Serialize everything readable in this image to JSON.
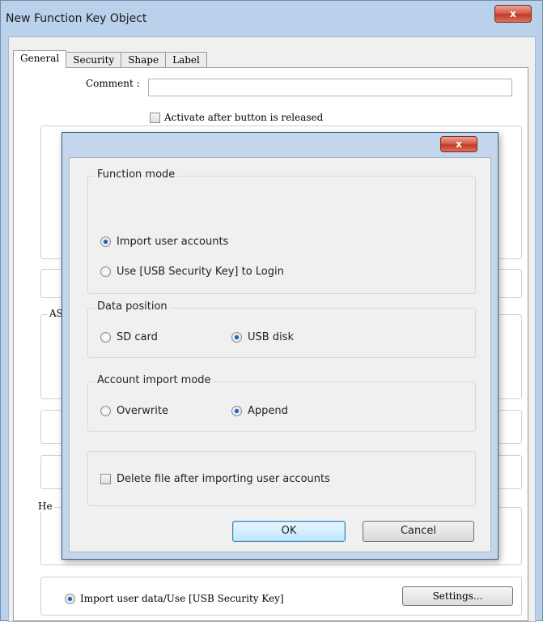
{
  "window": {
    "title": "New Function Key Object",
    "close_label": "x"
  },
  "tabs": [
    {
      "label": "General",
      "active": true
    },
    {
      "label": "Security",
      "active": false
    },
    {
      "label": "Shape",
      "active": false
    },
    {
      "label": "Label",
      "active": false
    }
  ],
  "general": {
    "comment_label": "Comment :",
    "comment_value": "",
    "activate_label": "Activate after button is released",
    "activate_checked": false,
    "group_captions": {
      "ascii": "AS",
      "hardware": "He"
    },
    "import_option_label": "Import user data/Use [USB Security Key]",
    "import_option_selected": true,
    "settings_button": "Settings..."
  },
  "dialog": {
    "close_label": "x",
    "function_mode": {
      "title": "Function mode",
      "options": [
        {
          "label": "Import user accounts",
          "selected": true
        },
        {
          "label": "Use [USB Security Key] to Login",
          "selected": false
        }
      ]
    },
    "data_position": {
      "title": "Data position",
      "options": [
        {
          "label": "SD card",
          "selected": false
        },
        {
          "label": "USB disk",
          "selected": true
        }
      ]
    },
    "account_import_mode": {
      "title": "Account import mode",
      "options": [
        {
          "label": "Overwrite",
          "selected": false
        },
        {
          "label": "Append",
          "selected": true
        }
      ]
    },
    "delete_file_label": "Delete file after importing user accounts",
    "delete_file_checked": false,
    "ok_button": "OK",
    "cancel_button": "Cancel"
  },
  "colors": {
    "window_frame": "#b9d1ea",
    "close_button": "#c23a26",
    "radio_selected": "#1f5fb5"
  }
}
